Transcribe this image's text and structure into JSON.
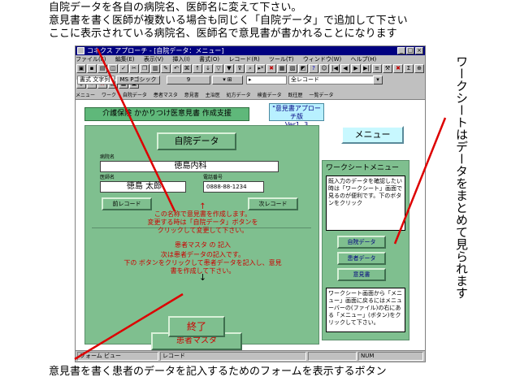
{
  "annotations": {
    "top_line1": "自院データを各自の病院名、医師名に変えて下さい。",
    "top_line2": "意見書を書く医師が複数いる場合も同じく「自院データ」で追加して下さい",
    "top_line3": "ここに表示されている病院名、医師名で意見書が書かれることになります",
    "right_vertical": "ワークシートはデータをまとめて見られます",
    "bottom": "意見書を書く患者のデータを記入するためのフォームを表示するボタン",
    "arrow_color": "#dd0000"
  },
  "window": {
    "title": "コネクス アプローチ - [自院データ：メニュー]",
    "menu": [
      "ファイル(F)",
      "編集(E)",
      "表示(V)",
      "挿入(I)",
      "書式(O)",
      "レコード(R)",
      "ツール(T)",
      "ウィンドウ(W)",
      "ヘルプ(H)"
    ]
  },
  "toolbar2": {
    "field1": "書式 文字列",
    "field2": "MS Pゴシック",
    "field3": "9",
    "field4": "全レコード"
  },
  "tabs": [
    "メニュー",
    "ワーク",
    "自院データ",
    "患者マスタ",
    "意見書",
    "主治医",
    "処方データ",
    "検査データ",
    "既往歴",
    "一覧データ"
  ],
  "header": {
    "title": "介護保険 かかりつけ医意見書 作成支援",
    "version_line1": "\"意見書アプローチ版",
    "version_line2": "Ver1. 3"
  },
  "form": {
    "title_button": "自院データ",
    "hospital_label": "病院名",
    "hospital_value": "徳島内科",
    "doctor_label": "医師名",
    "doctor_value": "徳島 太郎",
    "phone_label": "電話番号",
    "phone_value": "0888-88-1234",
    "prev_button": "前レコード",
    "next_button": "次レコード",
    "red_note1": "この名称で意見書を作成します。",
    "red_note2": "変更する時は「自院データ」ボタンを",
    "red_note3": "クリックして変更して下さい。",
    "patient_heading": "患者マスタ の 記入",
    "patient_note1": "次は患者データの記入です。",
    "patient_note2": "下の ボタンをクリックして患者データを記入し、意見",
    "patient_note3": "書を作成して下さい。",
    "patient_button": "患者マスタ",
    "exit_button": "終了"
  },
  "side": {
    "menu_button": "メニュー",
    "worksheet_title": "ワークシートメニュー",
    "box1_text": "既入力のデータを確認したい時は「ワークシート」画面で見るのが便利です。下のボタンをクリック",
    "buttons": [
      "自院データ",
      "患者データ",
      "意見書"
    ],
    "box2_text": "ワークシート画面から「メニュー」画面に戻るにはメニューバーの(ファイル)の右にある「メニュー」(ボタン)をクリックして下さい。"
  },
  "status": {
    "cell1": "フォーム ビュー",
    "cell2": "レコード",
    "cell3": "NUM"
  }
}
